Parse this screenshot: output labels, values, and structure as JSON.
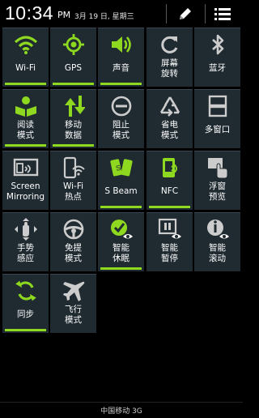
{
  "status_bar": {
    "time": "10:34",
    "ampm": "PM",
    "date": "3月 19 日, 星期三",
    "edit_icon": "pencil-icon",
    "menu_icon": "list-menu-icon"
  },
  "accent_color": "#8ed81f",
  "tiles": [
    {
      "label": "Wi-Fi",
      "icon": "wifi-icon",
      "active": true
    },
    {
      "label": "GPS",
      "icon": "gps-icon",
      "active": true
    },
    {
      "label": "声音",
      "icon": "sound-icon",
      "active": true
    },
    {
      "label": "屏幕\n旋转",
      "icon": "rotate-icon",
      "active": false
    },
    {
      "label": "蓝牙",
      "icon": "bluetooth-icon",
      "active": false
    },
    {
      "label": "阅读\n模式",
      "icon": "reading-icon",
      "active": true
    },
    {
      "label": "移动\n数据",
      "icon": "mobile-data-icon",
      "active": true
    },
    {
      "label": "阻止\n模式",
      "icon": "block-icon",
      "active": false
    },
    {
      "label": "省电\n模式",
      "icon": "recycle-icon",
      "active": false
    },
    {
      "label": "多窗口",
      "icon": "multiwindow-icon",
      "active": false
    },
    {
      "label": "Screen\nMirroring",
      "icon": "screen-mirroring-icon",
      "active": false
    },
    {
      "label": "Wi-Fi\n热点",
      "icon": "wifi-hotspot-icon",
      "active": false
    },
    {
      "label": "S Beam",
      "icon": "s-beam-icon",
      "active": true
    },
    {
      "label": "NFC",
      "icon": "nfc-icon",
      "active": true
    },
    {
      "label": "浮窗\n预览",
      "icon": "air-view-icon",
      "active": false
    },
    {
      "label": "手势\n感应",
      "icon": "gesture-icon",
      "active": false
    },
    {
      "label": "免提\n模式",
      "icon": "steering-wheel-icon",
      "active": false
    },
    {
      "label": "智能\n休眠",
      "icon": "smart-stay-icon",
      "active": true
    },
    {
      "label": "智能\n暂停",
      "icon": "smart-pause-icon",
      "active": false
    },
    {
      "label": "智能\n滚动",
      "icon": "smart-scroll-icon",
      "active": false
    },
    {
      "label": "同步",
      "icon": "sync-icon",
      "active": true
    },
    {
      "label": "飞行\n模式",
      "icon": "airplane-icon",
      "active": false
    }
  ],
  "carrier": "中国移动 3G"
}
